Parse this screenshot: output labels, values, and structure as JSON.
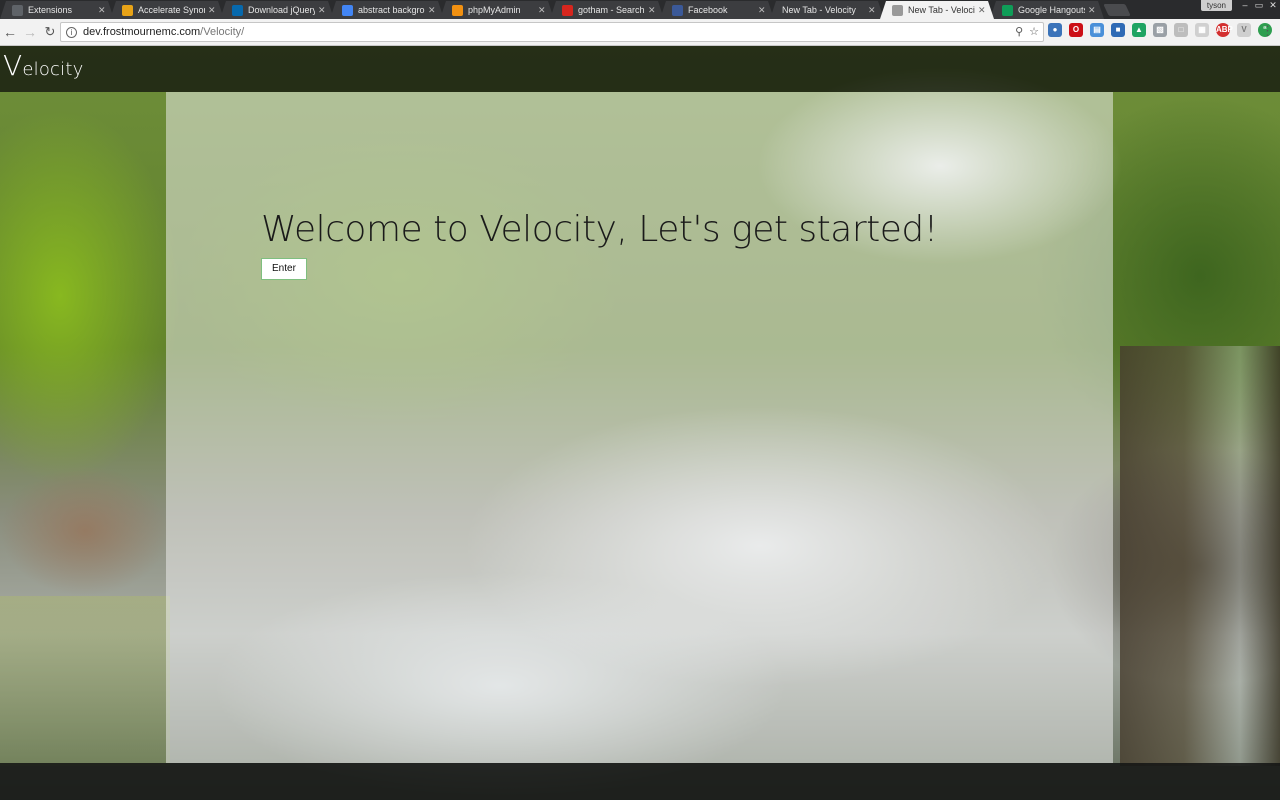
{
  "browser": {
    "tabs": [
      {
        "title": "Extensions",
        "favicon": "extensions-icon",
        "color": "#5f6368",
        "active": false
      },
      {
        "title": "Accelerate Synonym",
        "favicon": "thesaurus-icon",
        "color": "#e8a317",
        "active": false
      },
      {
        "title": "Download jQuery | j",
        "favicon": "jquery-icon",
        "color": "#0769ad",
        "active": false
      },
      {
        "title": "abstract background",
        "favicon": "google-icon",
        "color": "#4285f4",
        "active": false
      },
      {
        "title": "phpMyAdmin",
        "favicon": "phpmyadmin-icon",
        "color": "#f29111",
        "active": false
      },
      {
        "title": "gotham - Search - d",
        "favicon": "deviantart-icon",
        "color": "#d7261e",
        "active": false
      },
      {
        "title": "Facebook",
        "favicon": "facebook-icon",
        "color": "#3b5998",
        "active": false
      },
      {
        "title": "New Tab - Velocity",
        "favicon": "",
        "color": "#3c3d40",
        "active": false
      },
      {
        "title": "New Tab - Velocity",
        "favicon": "page-icon",
        "color": "#999999",
        "active": true
      },
      {
        "title": "Google Hangouts - ",
        "favicon": "hangouts-icon",
        "color": "#0f9d58",
        "active": false
      }
    ],
    "user": "tyson",
    "address": {
      "host": "dev.frostmournemc.com",
      "path": "/Velocity/"
    }
  },
  "site": {
    "brand_initial": "V",
    "brand_rest": "elocity",
    "welcome_text": "Welcome to Velocity, Let's get started!",
    "enter_label": "Enter"
  }
}
